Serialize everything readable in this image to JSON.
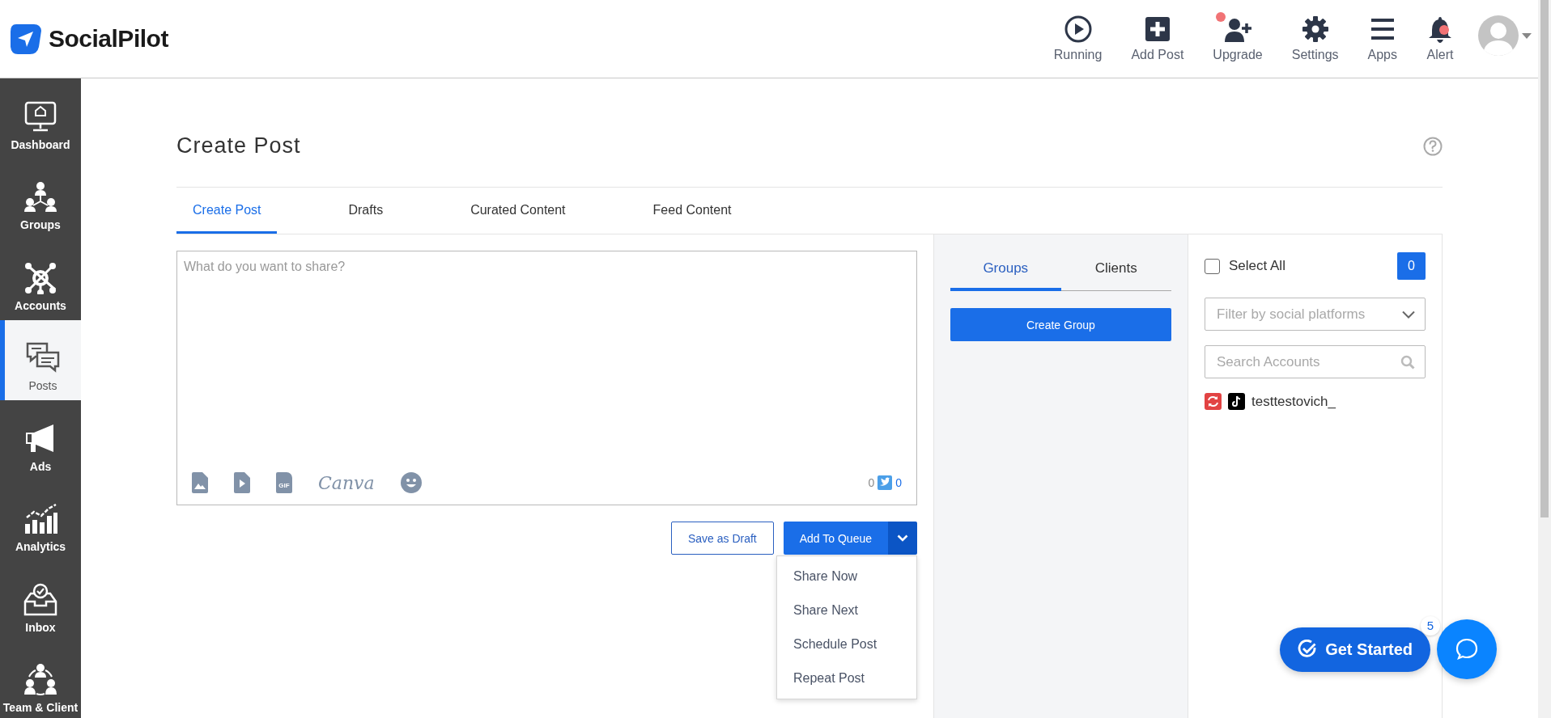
{
  "header": {
    "logo": "SocialPilot",
    "actions": [
      {
        "kind": "running",
        "label": "Running",
        "dot": false
      },
      {
        "kind": "add",
        "label": "Add Post",
        "dot": false
      },
      {
        "kind": "upgrade",
        "label": "Upgrade",
        "dot": true
      },
      {
        "kind": "settings",
        "label": "Settings",
        "dot": false
      },
      {
        "kind": "apps",
        "label": "Apps",
        "dot": false
      },
      {
        "kind": "alert",
        "label": "Alert",
        "dot": true
      }
    ]
  },
  "sidebar": {
    "items": [
      {
        "kind": "dashboard",
        "label": "Dashboard",
        "selected": false
      },
      {
        "kind": "groups",
        "label": "Groups",
        "selected": false
      },
      {
        "kind": "accounts",
        "label": "Accounts",
        "selected": false
      },
      {
        "kind": "posts",
        "label": "Posts",
        "selected": true
      },
      {
        "kind": "ads",
        "label": "Ads",
        "selected": false
      },
      {
        "kind": "analytics",
        "label": "Analytics",
        "selected": false
      },
      {
        "kind": "inbox",
        "label": "Inbox",
        "selected": false
      },
      {
        "kind": "team",
        "label": "Team & Client",
        "selected": false
      }
    ]
  },
  "page": {
    "title": "Create Post"
  },
  "tabs": [
    {
      "label": "Create Post",
      "selected": true
    },
    {
      "label": "Drafts",
      "selected": false
    },
    {
      "label": "Curated Content",
      "selected": false
    },
    {
      "label": "Feed Content",
      "selected": false
    }
  ],
  "editor": {
    "placeholder": "What do you want to share?",
    "tools": [
      {
        "kind": "image"
      },
      {
        "kind": "video"
      },
      {
        "kind": "gif",
        "label": "GIF"
      },
      {
        "kind": "canva",
        "label": "Canva"
      },
      {
        "kind": "emoji"
      }
    ],
    "counters": [
      "0",
      "0"
    ]
  },
  "actions": {
    "save_draft": "Save as Draft",
    "add_to_queue": "Add To Queue"
  },
  "queue_menu": {
    "expanded": true,
    "items": [
      "Share Now",
      "Share Next",
      "Schedule Post",
      "Repeat Post"
    ]
  },
  "groups_panel": {
    "tabs": [
      {
        "label": "Groups",
        "selected": true
      },
      {
        "label": "Clients",
        "selected": false
      }
    ],
    "create_button": "Create Group"
  },
  "accounts_panel": {
    "select_all": {
      "label": "Select All",
      "checked": false
    },
    "count": "0",
    "filter": {
      "placeholder": "Filter by social platforms"
    },
    "search": {
      "placeholder": "Search Accounts"
    },
    "accounts": [
      {
        "name": "testtestovich_",
        "error": true
      }
    ]
  },
  "get_started": {
    "label": "Get Started",
    "badge": "5"
  }
}
